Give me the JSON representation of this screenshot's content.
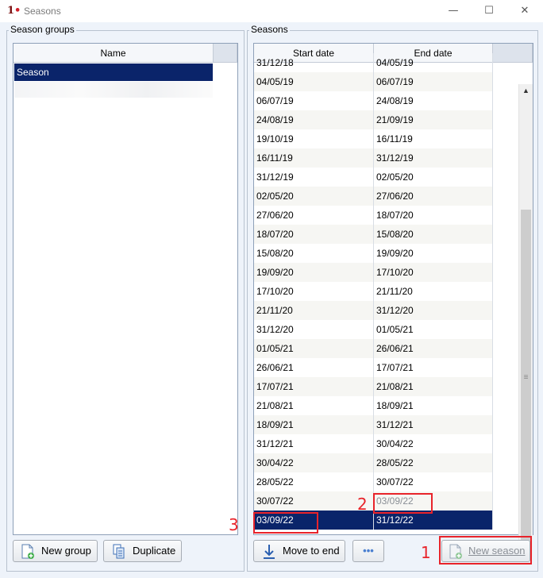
{
  "window": {
    "title": "Seasons",
    "minimize_icon": "minimize-icon",
    "maximize_icon": "maximize-icon",
    "close_icon": "close-icon"
  },
  "season_groups": {
    "label": "Season groups",
    "column_name": "Name",
    "items": [
      "Season"
    ],
    "selected": "Season"
  },
  "seasons": {
    "label": "Seasons",
    "columns": [
      "Start date",
      "End date"
    ],
    "rows": [
      [
        "31/12/18",
        "04/05/19"
      ],
      [
        "04/05/19",
        "06/07/19"
      ],
      [
        "06/07/19",
        "24/08/19"
      ],
      [
        "24/08/19",
        "21/09/19"
      ],
      [
        "19/10/19",
        "16/11/19"
      ],
      [
        "16/11/19",
        "31/12/19"
      ],
      [
        "31/12/19",
        "02/05/20"
      ],
      [
        "02/05/20",
        "27/06/20"
      ],
      [
        "27/06/20",
        "18/07/20"
      ],
      [
        "18/07/20",
        "15/08/20"
      ],
      [
        "15/08/20",
        "19/09/20"
      ],
      [
        "19/09/20",
        "17/10/20"
      ],
      [
        "17/10/20",
        "21/11/20"
      ],
      [
        "21/11/20",
        "31/12/20"
      ],
      [
        "31/12/20",
        "01/05/21"
      ],
      [
        "01/05/21",
        "26/06/21"
      ],
      [
        "26/06/21",
        "17/07/21"
      ],
      [
        "17/07/21",
        "21/08/21"
      ],
      [
        "21/08/21",
        "18/09/21"
      ],
      [
        "18/09/21",
        "31/12/21"
      ],
      [
        "31/12/21",
        "30/04/22"
      ],
      [
        "30/04/22",
        "28/05/22"
      ],
      [
        "28/05/22",
        "30/07/22"
      ],
      [
        "30/07/22",
        "03/09/22"
      ],
      [
        "03/09/22",
        "31/12/22"
      ]
    ],
    "selected_row_index": 24
  },
  "buttons": {
    "new_group": "New group",
    "duplicate": "Duplicate",
    "move_to_end": "Move to end",
    "more": "•••",
    "new_season": "New season"
  },
  "annotations": {
    "one": "1",
    "two": "2",
    "three": "3"
  },
  "colors": {
    "selection": "#0a246a",
    "annotation_red": "#e8232a",
    "panel_bg": "#eef3fa"
  }
}
